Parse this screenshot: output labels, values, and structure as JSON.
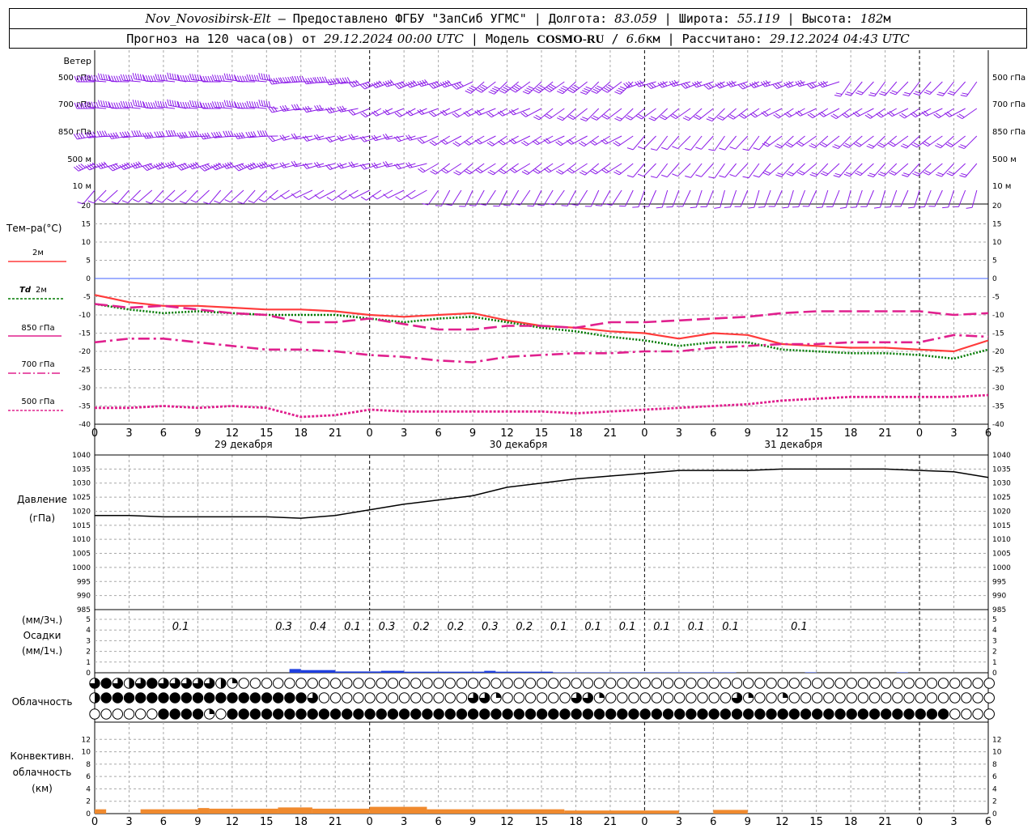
{
  "header": {
    "station": "Nov_Novosibirsk-Elt",
    "provider": " – Предоставлено ФГБУ \"ЗапСиб УГМС\" | Долгота: ",
    "lon": "83.059",
    "lat_label": " | Широта: ",
    "lat": "55.119",
    "alt_label": " | Высота: ",
    "alt": "182",
    "alt_unit": "м",
    "forecast_label": "Прогноз на 120 часа(ов) от ",
    "forecast_start": "29.12.2024 00:00 UTC",
    "model_label": "  | Модель ",
    "model": "COSMO-RU",
    "res_sep": " / ",
    "res": "6.6",
    "res_unit": "км",
    "calc_label": " | Рассчитано: ",
    "calc_time": "29.12.2024 04:43 UTC"
  },
  "labels": {
    "wind": "Ветер",
    "wind_levels": [
      "500 гПа",
      "700 гПа",
      "850 гПа",
      "500 м",
      "10 м"
    ],
    "temp_title": "Тем–ра(°C)",
    "t2m": "2м",
    "td": "Td",
    "td2m": "2м",
    "t850": "850 гПа",
    "t700": "700 гПа",
    "t500": "500 гПа",
    "pressure_1": "Давление",
    "pressure_2": "(гПа)",
    "precip_1": "(мм/3ч.)",
    "precip_2": "Осадки",
    "precip_3": "(мм/1ч.)",
    "cloud": "Облачность",
    "conv_1": "Конвективн.",
    "conv_2": "облачность",
    "conv_3": "(км)"
  },
  "days": [
    "29 декабря",
    "30 декабря",
    "31 декабря"
  ],
  "colors": {
    "t2m": "#ff3b3b",
    "td2m": "#007a00",
    "t850": "#e0208e",
    "t700": "#e0208e",
    "t500": "#e0208e",
    "wind": "#8b1ae8",
    "pressure": "#000000",
    "precip": "#1f3fe0",
    "conv": "#f08a2e",
    "zero_line": "#4060ff"
  },
  "chart_data": [
    {
      "type": "line",
      "title": "Тем–ра(°C)",
      "x_hours": [
        0,
        3,
        6,
        9,
        12,
        15,
        18,
        21,
        24,
        27,
        30,
        33,
        36,
        39,
        42,
        45,
        48,
        51,
        54,
        57,
        60,
        63,
        66,
        69,
        72,
        75,
        78
      ],
      "x_ticks": [
        "0",
        "3",
        "6",
        "9",
        "12",
        "15",
        "18",
        "21",
        "0",
        "3",
        "6",
        "9",
        "12",
        "15",
        "18",
        "21",
        "0",
        "3",
        "6",
        "9",
        "12",
        "15",
        "18",
        "21",
        "0",
        "3",
        "6"
      ],
      "ylim": [
        -40,
        20
      ],
      "yticks": [
        -40,
        -35,
        -30,
        -25,
        -20,
        -15,
        -10,
        -5,
        0,
        5,
        10,
        15,
        20
      ],
      "series": [
        {
          "name": "2м",
          "values": [
            -4.5,
            -6.5,
            -7.5,
            -7.5,
            -8.0,
            -8.5,
            -8.5,
            -9.0,
            -10.0,
            -10.5,
            -10.0,
            -9.5,
            -11.5,
            -13.0,
            -13.5,
            -14.5,
            -15.0,
            -16.5,
            -15.0,
            -15.5,
            -18.0,
            -18.5,
            -19.0,
            -19.0,
            -19.5,
            -20.0,
            -17.0
          ]
        },
        {
          "name": "Td 2м",
          "values": [
            -7.0,
            -8.5,
            -9.5,
            -9.0,
            -9.5,
            -10.0,
            -10.0,
            -10.0,
            -11.0,
            -12.0,
            -11.0,
            -10.5,
            -12.0,
            -13.5,
            -14.5,
            -16.0,
            -17.0,
            -18.5,
            -17.5,
            -17.5,
            -19.5,
            -20.0,
            -20.5,
            -20.5,
            -21.0,
            -22.0,
            -19.5
          ]
        },
        {
          "name": "850 гПа",
          "values": [
            -7.0,
            -8.0,
            -7.5,
            -8.5,
            -9.5,
            -10.0,
            -12.0,
            -12.0,
            -11.0,
            -12.5,
            -14.0,
            -14.0,
            -13.0,
            -13.0,
            -13.5,
            -12.0,
            -12.0,
            -11.5,
            -11.0,
            -10.5,
            -9.5,
            -9.0,
            -9.0,
            -9.0,
            -9.0,
            -10.0,
            -9.5
          ]
        },
        {
          "name": "700 гПа",
          "values": [
            -17.5,
            -16.5,
            -16.5,
            -17.5,
            -18.5,
            -19.5,
            -19.5,
            -20.0,
            -21.0,
            -21.5,
            -22.5,
            -23.0,
            -21.5,
            -21.0,
            -20.5,
            -20.5,
            -20.0,
            -20.0,
            -19.0,
            -18.5,
            -18.0,
            -18.0,
            -17.5,
            -17.5,
            -17.5,
            -15.5,
            -16.0
          ]
        },
        {
          "name": "500 гПа",
          "values": [
            -35.5,
            -35.5,
            -35.0,
            -35.5,
            -35.0,
            -35.5,
            -38.0,
            -37.5,
            -36.0,
            -36.5,
            -36.5,
            -36.5,
            -36.5,
            -36.5,
            -37.0,
            -36.5,
            -36.0,
            -35.5,
            -35.0,
            -34.5,
            -33.5,
            -33.0,
            -32.5,
            -32.5,
            -32.5,
            -32.5,
            -32.0
          ]
        }
      ]
    },
    {
      "type": "line",
      "title": "Давление",
      "ylabel": "(гПа)",
      "x_hours": [
        0,
        3,
        6,
        9,
        12,
        15,
        18,
        21,
        24,
        27,
        30,
        33,
        36,
        39,
        42,
        45,
        48,
        51,
        54,
        57,
        60,
        63,
        66,
        69,
        72,
        75,
        78
      ],
      "ylim": [
        985,
        1040
      ],
      "yticks": [
        985,
        990,
        995,
        1000,
        1005,
        1010,
        1015,
        1020,
        1025,
        1030,
        1035,
        1040
      ],
      "series": [
        {
          "name": "Давление",
          "values": [
            1018.5,
            1018.5,
            1018.0,
            1018.0,
            1018.0,
            1018.0,
            1017.5,
            1018.5,
            1020.5,
            1022.5,
            1024.0,
            1025.5,
            1028.5,
            1030.0,
            1031.5,
            1032.5,
            1033.5,
            1034.5,
            1034.5,
            1034.5,
            1035.0,
            1035.0,
            1035.0,
            1035.0,
            1034.5,
            1034.0,
            1032.0
          ]
        }
      ]
    },
    {
      "type": "bar",
      "title": "Осадки",
      "ylim": [
        0,
        5
      ],
      "yticks": [
        0,
        1,
        2,
        3,
        4,
        5
      ],
      "labels_3h": [
        {
          "hour": 7.5,
          "text": "0.1"
        },
        {
          "hour": 16.5,
          "text": "0.3"
        },
        {
          "hour": 19.5,
          "text": "0.4"
        },
        {
          "hour": 22.5,
          "text": "0.1"
        },
        {
          "hour": 25.5,
          "text": "0.3"
        },
        {
          "hour": 28.5,
          "text": "0.2"
        },
        {
          "hour": 31.5,
          "text": "0.2"
        },
        {
          "hour": 34.5,
          "text": "0.3"
        },
        {
          "hour": 37.5,
          "text": "0.2"
        },
        {
          "hour": 40.5,
          "text": "0.1"
        },
        {
          "hour": 43.5,
          "text": "0.1"
        },
        {
          "hour": 46.5,
          "text": "0.1"
        },
        {
          "hour": 49.5,
          "text": "0.1"
        },
        {
          "hour": 52.5,
          "text": "0.1"
        },
        {
          "hour": 55.5,
          "text": "0.1"
        },
        {
          "hour": 61.5,
          "text": "0.1"
        }
      ],
      "bars_1h": [
        {
          "from": 17,
          "to": 18,
          "value": 0.35
        },
        {
          "from": 18,
          "to": 21,
          "value": 0.25
        },
        {
          "from": 21,
          "to": 25,
          "value": 0.12
        },
        {
          "from": 25,
          "to": 27,
          "value": 0.18
        },
        {
          "from": 27,
          "to": 34,
          "value": 0.1
        },
        {
          "from": 34,
          "to": 35,
          "value": 0.18
        },
        {
          "from": 35,
          "to": 40,
          "value": 0.1
        },
        {
          "from": 40,
          "to": 56,
          "value": 0.04
        },
        {
          "from": 62,
          "to": 63,
          "value": 0.04
        },
        {
          "from": 70,
          "to": 71,
          "value": 0.04
        }
      ]
    },
    {
      "type": "table",
      "title": "Облачность",
      "rows_description": "cloud cover fraction per hour (0=clear, 1=overcast)",
      "high": [
        0.75,
        1,
        0.75,
        0.5,
        0.75,
        1,
        0.75,
        0.75,
        0.75,
        0.75,
        0.75,
        0.5,
        0.25,
        0,
        0,
        0,
        0,
        0,
        0,
        0,
        0,
        0,
        0,
        0,
        0,
        0,
        0,
        0,
        0,
        0,
        0,
        0,
        0,
        0,
        0,
        0,
        0,
        0,
        0,
        0,
        0,
        0,
        0,
        0,
        0,
        0,
        0,
        0,
        0,
        0,
        0,
        0,
        0,
        0,
        0,
        0,
        0,
        0,
        0,
        0,
        0,
        0,
        0,
        0,
        0,
        0,
        0,
        0,
        0,
        0,
        0,
        0,
        0,
        0,
        0,
        0,
        0,
        0,
        0
      ],
      "middle": [
        0.5,
        1,
        1,
        1,
        1,
        1,
        1,
        1,
        1,
        1,
        1,
        1,
        1,
        1,
        1,
        1,
        1,
        1,
        1,
        0.75,
        0,
        0,
        0,
        0,
        0,
        0,
        0,
        0,
        0,
        0,
        0,
        0,
        0,
        0.75,
        0.75,
        0.25,
        0,
        0,
        0,
        0,
        0,
        0,
        0.75,
        0.75,
        0.25,
        0,
        0,
        0,
        0,
        0,
        0,
        0,
        0,
        0,
        0,
        0,
        0.75,
        0.25,
        0,
        0,
        0.25,
        0,
        0,
        0,
        0,
        0,
        0,
        0,
        0,
        0,
        0,
        0,
        0,
        0,
        0,
        0,
        0,
        0,
        0
      ],
      "low": [
        0,
        0,
        0,
        0,
        0,
        0,
        1,
        1,
        1,
        1,
        0.25,
        0,
        1,
        1,
        1,
        1,
        1,
        1,
        1,
        1,
        1,
        1,
        1,
        1,
        1,
        1,
        1,
        1,
        1,
        1,
        1,
        1,
        1,
        1,
        1,
        1,
        1,
        1,
        1,
        1,
        1,
        1,
        1,
        1,
        1,
        1,
        1,
        1,
        1,
        1,
        1,
        1,
        1,
        1,
        1,
        1,
        1,
        1,
        1,
        1,
        1,
        1,
        1,
        1,
        1,
        1,
        1,
        1,
        1,
        1,
        1,
        1,
        1,
        1,
        1,
        0,
        0,
        0,
        0
      ]
    },
    {
      "type": "area",
      "title": "Конвективн. облачность",
      "ylabel": "(км)",
      "ylim": [
        0,
        14
      ],
      "yticks": [
        0,
        2,
        4,
        6,
        8,
        10,
        12
      ],
      "values": [
        {
          "from": 0,
          "to": 1,
          "value": 0.7
        },
        {
          "from": 4,
          "to": 9,
          "value": 0.7
        },
        {
          "from": 9,
          "to": 10,
          "value": 0.9
        },
        {
          "from": 10,
          "to": 16,
          "value": 0.8
        },
        {
          "from": 16,
          "to": 19,
          "value": 1.0
        },
        {
          "from": 19,
          "to": 24,
          "value": 0.8
        },
        {
          "from": 24,
          "to": 29,
          "value": 1.1
        },
        {
          "from": 29,
          "to": 41,
          "value": 0.7
        },
        {
          "from": 41,
          "to": 51,
          "value": 0.5
        },
        {
          "from": 54,
          "to": 57,
          "value": 0.6
        }
      ]
    }
  ],
  "wind_barbs": {
    "description": "wind direction (deg, from) and speed (m/s) by segment",
    "levels": [
      {
        "name": "500 гПа",
        "segments": [
          {
            "from": 0,
            "to": 17,
            "dir": 275,
            "spd": 30
          },
          {
            "from": 17,
            "to": 24,
            "dir": 265,
            "spd": 25
          },
          {
            "from": 24,
            "to": 34,
            "dir": 250,
            "spd": 22
          },
          {
            "from": 34,
            "to": 48,
            "dir": 230,
            "spd": 20
          },
          {
            "from": 48,
            "to": 66,
            "dir": 250,
            "spd": 15
          },
          {
            "from": 66,
            "to": 79,
            "dir": 220,
            "spd": 12
          }
        ]
      },
      {
        "name": "700 гПа",
        "segments": [
          {
            "from": 0,
            "to": 17,
            "dir": 275,
            "spd": 25
          },
          {
            "from": 17,
            "to": 24,
            "dir": 260,
            "spd": 18
          },
          {
            "from": 24,
            "to": 40,
            "dir": 245,
            "spd": 14
          },
          {
            "from": 40,
            "to": 58,
            "dir": 230,
            "spd": 12
          },
          {
            "from": 58,
            "to": 79,
            "dir": 240,
            "spd": 10
          }
        ]
      },
      {
        "name": "850 гПа",
        "segments": [
          {
            "from": 0,
            "to": 17,
            "dir": 265,
            "spd": 22
          },
          {
            "from": 17,
            "to": 30,
            "dir": 255,
            "spd": 14
          },
          {
            "from": 30,
            "to": 48,
            "dir": 240,
            "spd": 10
          },
          {
            "from": 48,
            "to": 60,
            "dir": 220,
            "spd": 7
          },
          {
            "from": 60,
            "to": 79,
            "dir": 230,
            "spd": 10
          }
        ]
      },
      {
        "name": "500 м",
        "segments": [
          {
            "from": 0,
            "to": 17,
            "dir": 250,
            "spd": 20
          },
          {
            "from": 17,
            "to": 30,
            "dir": 255,
            "spd": 12
          },
          {
            "from": 30,
            "to": 48,
            "dir": 235,
            "spd": 10
          },
          {
            "from": 48,
            "to": 60,
            "dir": 220,
            "spd": 8
          },
          {
            "from": 60,
            "to": 79,
            "dir": 225,
            "spd": 10
          }
        ]
      },
      {
        "name": "10 м",
        "segments": [
          {
            "from": 0,
            "to": 17,
            "dir": 225,
            "spd": 8
          },
          {
            "from": 17,
            "to": 30,
            "dir": 240,
            "spd": 5
          },
          {
            "from": 30,
            "to": 48,
            "dir": 210,
            "spd": 5
          },
          {
            "from": 48,
            "to": 79,
            "dir": 200,
            "spd": 6
          }
        ]
      }
    ]
  }
}
